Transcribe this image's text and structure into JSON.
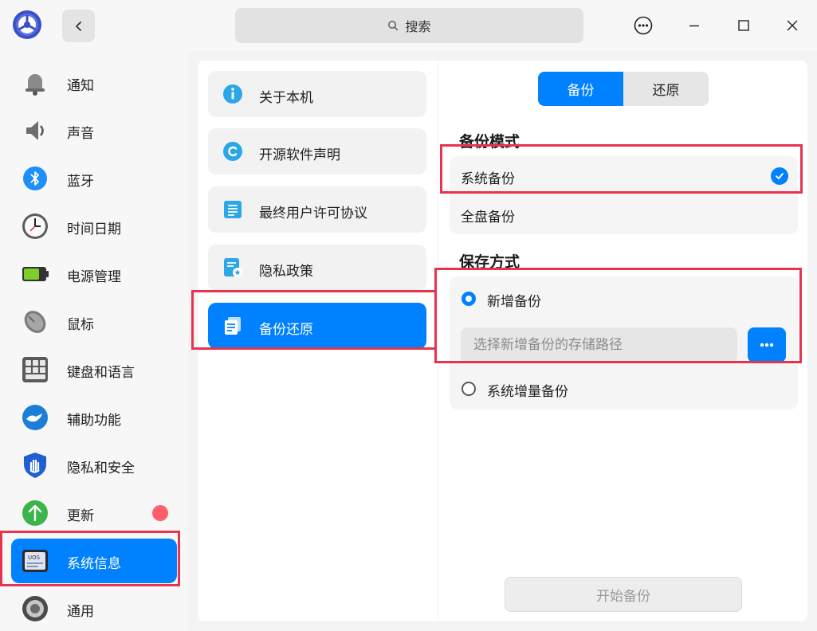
{
  "titlebar": {
    "search_placeholder": "搜索"
  },
  "sidebar": {
    "items": [
      {
        "label": "通知",
        "icon": "bell-icon"
      },
      {
        "label": "声音",
        "icon": "speaker-icon"
      },
      {
        "label": "蓝牙",
        "icon": "bluetooth-icon"
      },
      {
        "label": "时间日期",
        "icon": "clock-icon"
      },
      {
        "label": "电源管理",
        "icon": "battery-icon"
      },
      {
        "label": "鼠标",
        "icon": "mouse-icon"
      },
      {
        "label": "键盘和语言",
        "icon": "keyboard-icon"
      },
      {
        "label": "辅助功能",
        "icon": "accessibility-icon"
      },
      {
        "label": "隐私和安全",
        "icon": "shield-icon"
      },
      {
        "label": "更新",
        "icon": "update-arrow-icon"
      },
      {
        "label": "系统信息",
        "icon": "system-info-icon"
      },
      {
        "label": "通用",
        "icon": "gear-icon"
      }
    ],
    "active": "系统信息",
    "update_badge_color": "#ff5f6a",
    "system_info_icon_text": "UOS"
  },
  "middle": {
    "items": [
      {
        "label": "关于本机",
        "icon": "info-icon"
      },
      {
        "label": "开源软件声明",
        "icon": "copyright-icon"
      },
      {
        "label": "最终用户许可协议",
        "icon": "document-icon"
      },
      {
        "label": "隐私政策",
        "icon": "privacy-doc-icon"
      },
      {
        "label": "备份还原",
        "icon": "backup-icon"
      }
    ],
    "active": "备份还原"
  },
  "right": {
    "tabs": {
      "backup": "备份",
      "restore": "还原",
      "selected": "备份"
    },
    "backup_mode": {
      "title": "备份模式",
      "system_backup": "系统备份",
      "full_backup": "全盘备份",
      "selected": "系统备份"
    },
    "save_method": {
      "title": "保存方式",
      "new_backup": "新增备份",
      "path_placeholder": "选择新增备份的存储路径",
      "incremental_backup": "系统增量备份",
      "selected": "新增备份"
    },
    "start_button": "开始备份"
  },
  "colors": {
    "accent": "#0081ff",
    "highlight_box": "#e8334f"
  }
}
